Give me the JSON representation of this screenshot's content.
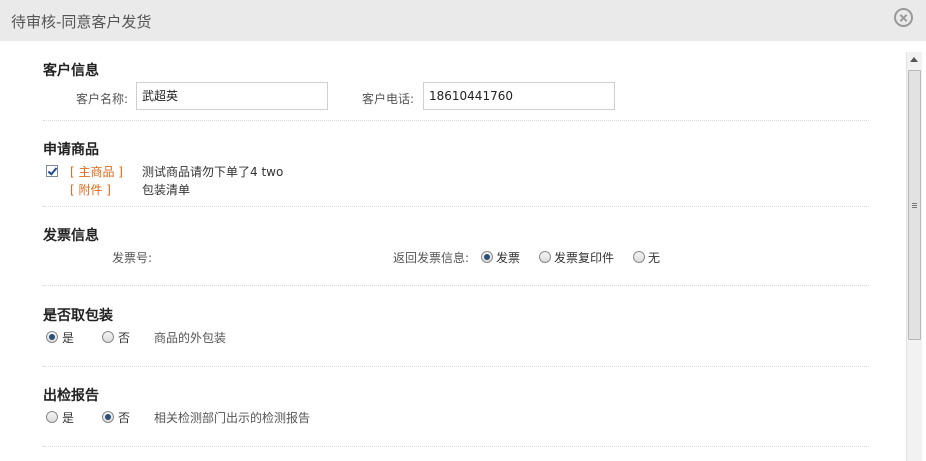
{
  "dialog": {
    "title": "待审核-同意客户发货",
    "close_icon": "close-icon"
  },
  "customer": {
    "section_title": "客户信息",
    "name_label": "客户名称:",
    "name_value": "武超英",
    "phone_label": "客户电话:",
    "phone_value": "18610441760"
  },
  "products": {
    "section_title": "申请商品",
    "items": [
      {
        "tag": "[ 主商品 ]",
        "name": "测试商品请勿下单了4 two",
        "checked": true
      },
      {
        "tag": "[ 附件 ]",
        "name": "包装清单"
      }
    ]
  },
  "invoice": {
    "section_title": "发票信息",
    "number_label": "发票号:",
    "return_label": "返回发票信息:",
    "options": [
      "发票",
      "发票复印件",
      "无"
    ],
    "selected": "发票"
  },
  "packaging": {
    "section_title": "是否取包装",
    "options": [
      "是",
      "否"
    ],
    "selected": "是",
    "hint": "商品的外包装"
  },
  "report": {
    "section_title": "出检报告",
    "options": [
      "是",
      "否"
    ],
    "selected": "否",
    "hint": "相关检测部门出示的检测报告"
  },
  "colors": {
    "accent_orange": "#e06a1b",
    "titlebar_bg": "#eaeaea"
  }
}
